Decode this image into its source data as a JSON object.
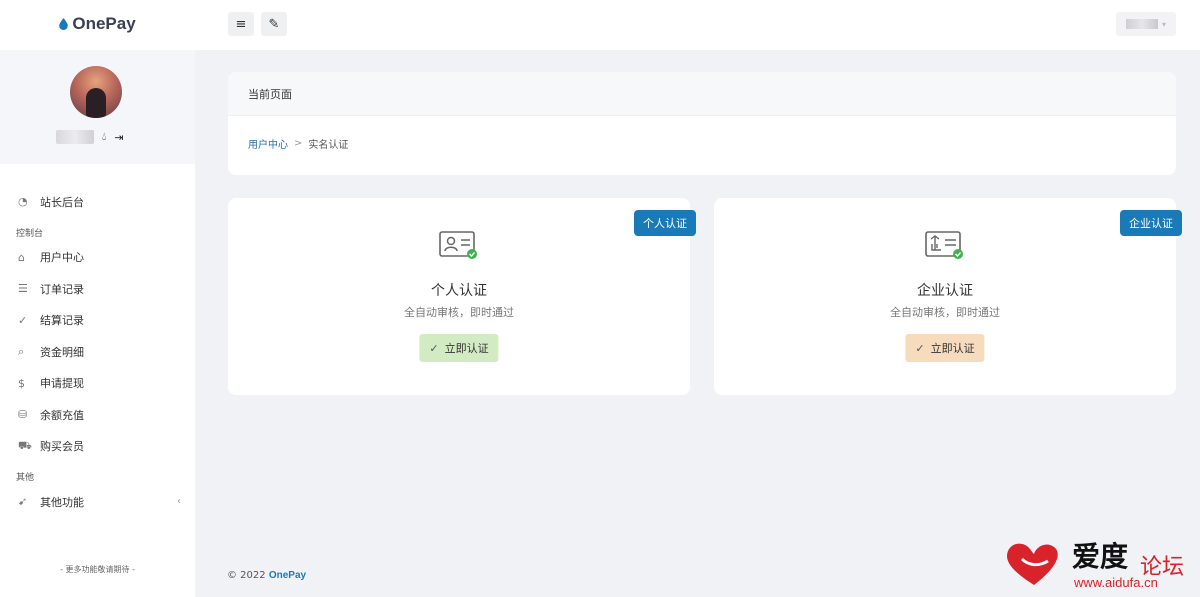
{
  "app": {
    "name": "OnePay",
    "brand_color": "#1a7ab8"
  },
  "header": {
    "menu_icon": "≡",
    "brush_icon": "✎"
  },
  "sidebar": {
    "admin_item": {
      "label": "站长后台",
      "icon": "gauge-icon"
    },
    "sections": [
      {
        "label": "控制台",
        "items": [
          {
            "label": "用户中心",
            "icon": "home-icon",
            "glyph": "⌂"
          },
          {
            "label": "订单记录",
            "icon": "list-icon",
            "glyph": "☰"
          },
          {
            "label": "结算记录",
            "icon": "check-circle-icon",
            "glyph": "✓"
          },
          {
            "label": "资金明细",
            "icon": "search-icon",
            "glyph": "⌕"
          },
          {
            "label": "申请提现",
            "icon": "dollar-icon",
            "glyph": "$"
          },
          {
            "label": "余额充值",
            "icon": "coin-stack-icon",
            "glyph": "⛁"
          },
          {
            "label": "购买会员",
            "icon": "cart-icon",
            "glyph": "⛟"
          }
        ]
      },
      {
        "label": "其他",
        "items": [
          {
            "label": "其他功能",
            "icon": "rocket-icon",
            "glyph": "➹"
          }
        ]
      }
    ],
    "footer": "- 更多功能敬请期待 -"
  },
  "page": {
    "title": "当前页面",
    "breadcrumb": {
      "parent": "用户中心",
      "separator": ">",
      "current": "实名认证"
    }
  },
  "cards": {
    "personal": {
      "badge": "个人认证",
      "title": "个人认证",
      "subtitle": "全自动审核，即时通过",
      "button": "立即认证",
      "button_color": "#d3ebc2"
    },
    "company": {
      "badge": "企业认证",
      "title": "企业认证",
      "subtitle": "全自动审核，即时通过",
      "button": "立即认证",
      "button_color": "#f6dcbd"
    }
  },
  "footer": {
    "copyright": "© 2022",
    "brand": "OnePay"
  },
  "watermark": {
    "main": "爱度",
    "sub": "论坛",
    "url": "www.aidufa.cn"
  }
}
